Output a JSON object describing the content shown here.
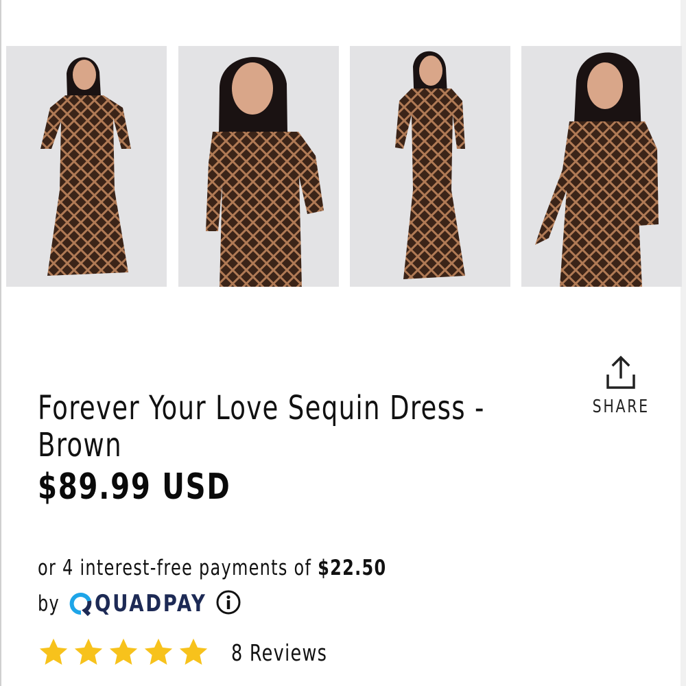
{
  "gallery": {
    "images": [
      {
        "icon": "product-photo-front-full"
      },
      {
        "icon": "product-photo-front-closeup"
      },
      {
        "icon": "product-photo-side-full"
      },
      {
        "icon": "product-photo-angle-closeup"
      }
    ]
  },
  "product": {
    "title": "Forever Your Love Sequin Dress - Brown",
    "price": "$89.99 USD"
  },
  "share": {
    "label": "SHARE",
    "icon": "share-icon"
  },
  "payment": {
    "prefix": "or 4 interest-free payments of ",
    "installment": "$22.50",
    "by_label": "by",
    "provider": "QUADPAY",
    "provider_color": "#1d2a55",
    "accent_color": "#1ea5e8",
    "info_icon": "info-icon"
  },
  "rating": {
    "stars": 5,
    "max_stars": 5,
    "star_color": "#f7c21c",
    "reviews_label": "8 Reviews"
  }
}
